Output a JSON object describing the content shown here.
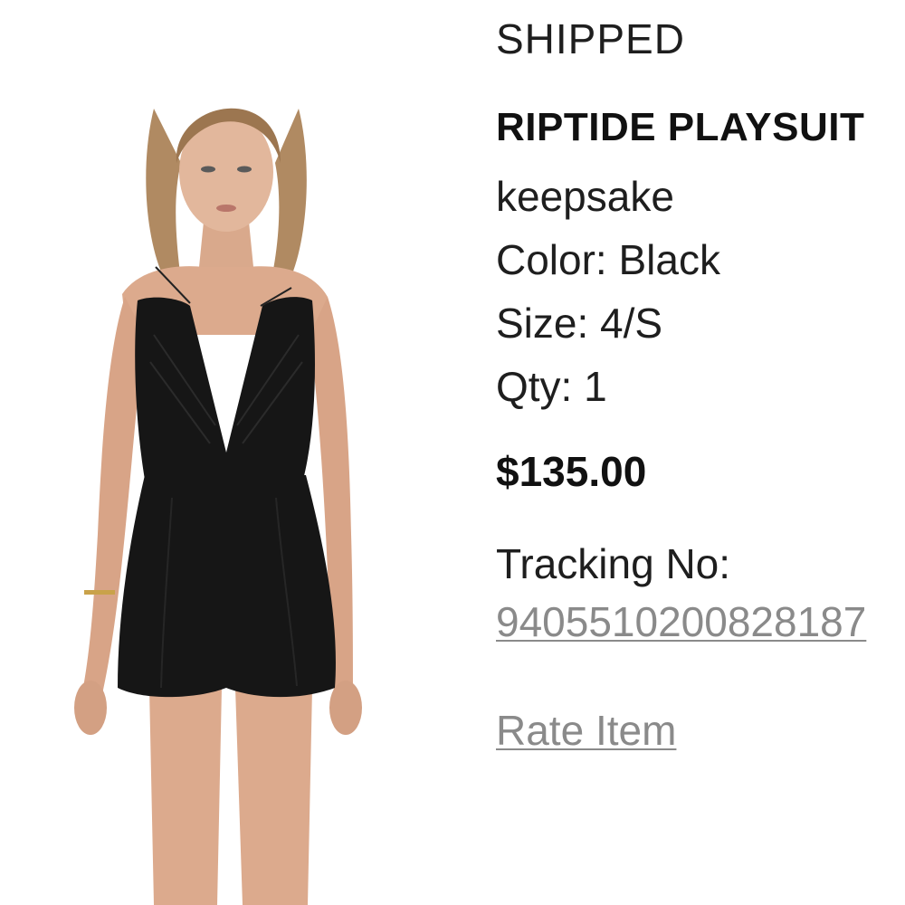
{
  "order_item": {
    "status": "SHIPPED",
    "product_name": "RIPTIDE PLAYSUIT",
    "brand": "keepsake",
    "color_line": "Color: Black",
    "size_line": "Size: 4/S",
    "qty_line": "Qty: 1",
    "price": "$135.00",
    "tracking_label": "Tracking No:",
    "tracking_number": "9405510200828187",
    "rate_item_label": "Rate Item"
  },
  "image": {
    "subject": "model wearing black plunging-neck playsuit",
    "garment_color": "#161616"
  }
}
